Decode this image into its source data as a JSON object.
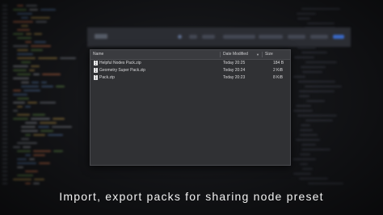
{
  "dialog": {
    "columns": {
      "name": "Name",
      "date": "Date Modified",
      "size": "Size"
    },
    "files": [
      {
        "name": "Helpful Nodes Pack.zip",
        "date": "Today 20:25",
        "size": "184 B"
      },
      {
        "name": "Geometry Super Pack.zip",
        "date": "Today 20:24",
        "size": "2 KiB"
      },
      {
        "name": "Pack.zip",
        "date": "Today 20:23",
        "size": "8 KiB"
      }
    ]
  },
  "caption": "Import, export packs for sharing node preset",
  "colors": {
    "syntax_orange": "#d9774a",
    "syntax_green": "#6e9f4e",
    "accent_blue": "#3a68c4"
  }
}
